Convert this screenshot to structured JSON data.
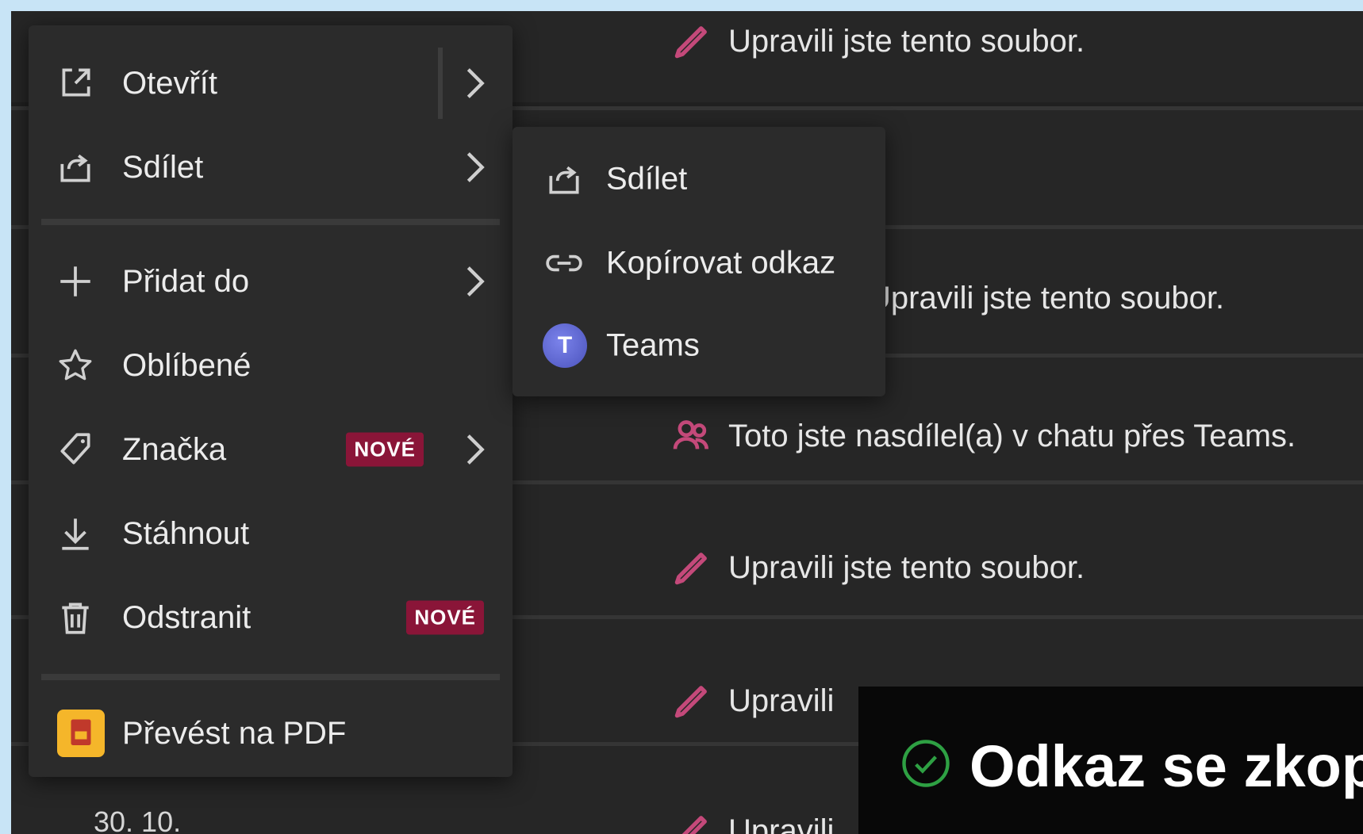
{
  "feed": {
    "rows": [
      {
        "text": "Upravili jste tento soubor.",
        "icon": "pencil-icon"
      },
      {
        "text": "Upravili jste tento soubor.",
        "icon": "pencil-icon"
      },
      {
        "text": "Toto jste nasdílel(a) v chatu přes Teams.",
        "icon": "people-icon"
      },
      {
        "text": "Upravili jste tento soubor.",
        "icon": "pencil-icon"
      },
      {
        "text": "Upravili",
        "icon": "pencil-icon"
      },
      {
        "text": "Upravili",
        "icon": "pencil-icon"
      }
    ],
    "date": "30. 10."
  },
  "menu": {
    "open": "Otevřít",
    "share": "Sdílet",
    "add_to": "Přidat do",
    "favorites": "Oblíbené",
    "tag": "Značka",
    "tag_badge": "NOVÉ",
    "download": "Stáhnout",
    "delete": "Odstranit",
    "delete_badge": "NOVÉ",
    "convert_pdf": "Převést na PDF"
  },
  "submenu": {
    "share": "Sdílet",
    "copy_link": "Kopírovat odkaz",
    "teams": "Teams",
    "teams_glyph": "T"
  },
  "toast": {
    "text": "Odkaz se zkopí"
  },
  "colors": {
    "accent_pink": "#c4497a",
    "badge": "#8a1538",
    "pdf_icon": "#f5b62a",
    "teams": "#5b5fc7",
    "success": "#2ea043"
  }
}
